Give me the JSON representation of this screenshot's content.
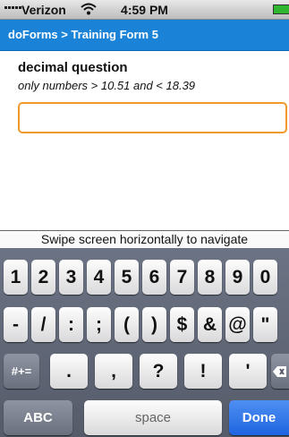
{
  "status": {
    "carrier": "Verizon",
    "time": "4:59 PM",
    "battery_color": "#2fb52f"
  },
  "nav": {
    "breadcrumb": "doForms > Training Form 5",
    "color": "#1a83d8"
  },
  "question": {
    "title": "decimal question",
    "hint": "only numbers > 10.51 and < 18.39",
    "value": "",
    "border_color": "#ef9a2b"
  },
  "swipe_hint": "Swipe screen horizontally to navigate",
  "keyboard": {
    "row1": [
      "1",
      "2",
      "3",
      "4",
      "5",
      "6",
      "7",
      "8",
      "9",
      "0"
    ],
    "row2": [
      "-",
      "/",
      ":",
      ";",
      "(",
      ")",
      "$",
      "&",
      "@",
      "\""
    ],
    "row3": {
      "shift": "#+=",
      "keys": [
        ".",
        ",",
        "?",
        "!",
        "'"
      ],
      "delete_icon": "backspace-icon"
    },
    "row4": {
      "abc": "ABC",
      "space": "space",
      "done": "Done"
    }
  }
}
